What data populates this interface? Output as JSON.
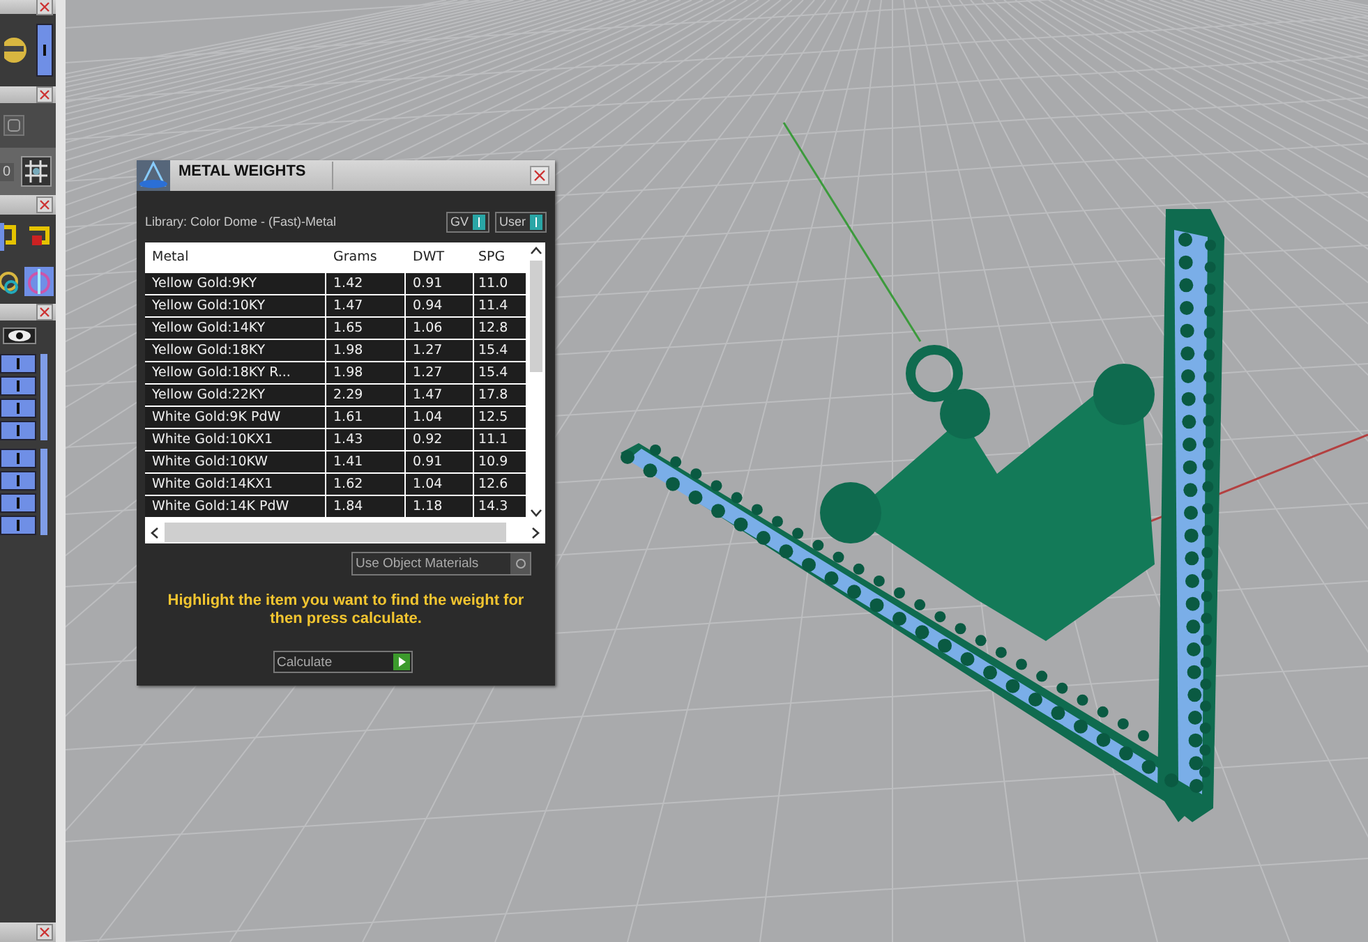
{
  "left_panel": {
    "field_value": "0"
  },
  "dialog": {
    "title": "METAL WEIGHTS",
    "library": "Library: Color Dome - (Fast)-Metal",
    "toggles": [
      {
        "label": "GV",
        "on": true
      },
      {
        "label": "User",
        "on": true
      }
    ],
    "table": {
      "columns": [
        "Metal",
        "Grams",
        "DWT",
        "SPG"
      ],
      "rows": [
        [
          "Yellow Gold:9KY",
          "1.42",
          "0.91",
          "11.0"
        ],
        [
          "Yellow Gold:10KY",
          "1.47",
          "0.94",
          "11.4"
        ],
        [
          "Yellow Gold:14KY",
          "1.65",
          "1.06",
          "12.8"
        ],
        [
          "Yellow Gold:18KY",
          "1.98",
          "1.27",
          "15.4"
        ],
        [
          "Yellow Gold:18KY R...",
          "1.98",
          "1.27",
          "15.4"
        ],
        [
          "Yellow Gold:22KY",
          "2.29",
          "1.47",
          "17.8"
        ],
        [
          "White Gold:9K PdW",
          "1.61",
          "1.04",
          "12.5"
        ],
        [
          "White Gold:10KX1",
          "1.43",
          "0.92",
          "11.1"
        ],
        [
          "White Gold:10KW",
          "1.41",
          "0.91",
          "10.9"
        ],
        [
          "White Gold:14KX1",
          "1.62",
          "1.04",
          "12.6"
        ],
        [
          "White Gold:14K PdW",
          "1.84",
          "1.18",
          "14.3"
        ]
      ]
    },
    "use_object_materials": {
      "label": "Use Object Materials",
      "checked": false
    },
    "hint": "Highlight the item you want to find the weight for then press calculate.",
    "button": "Calculate"
  }
}
